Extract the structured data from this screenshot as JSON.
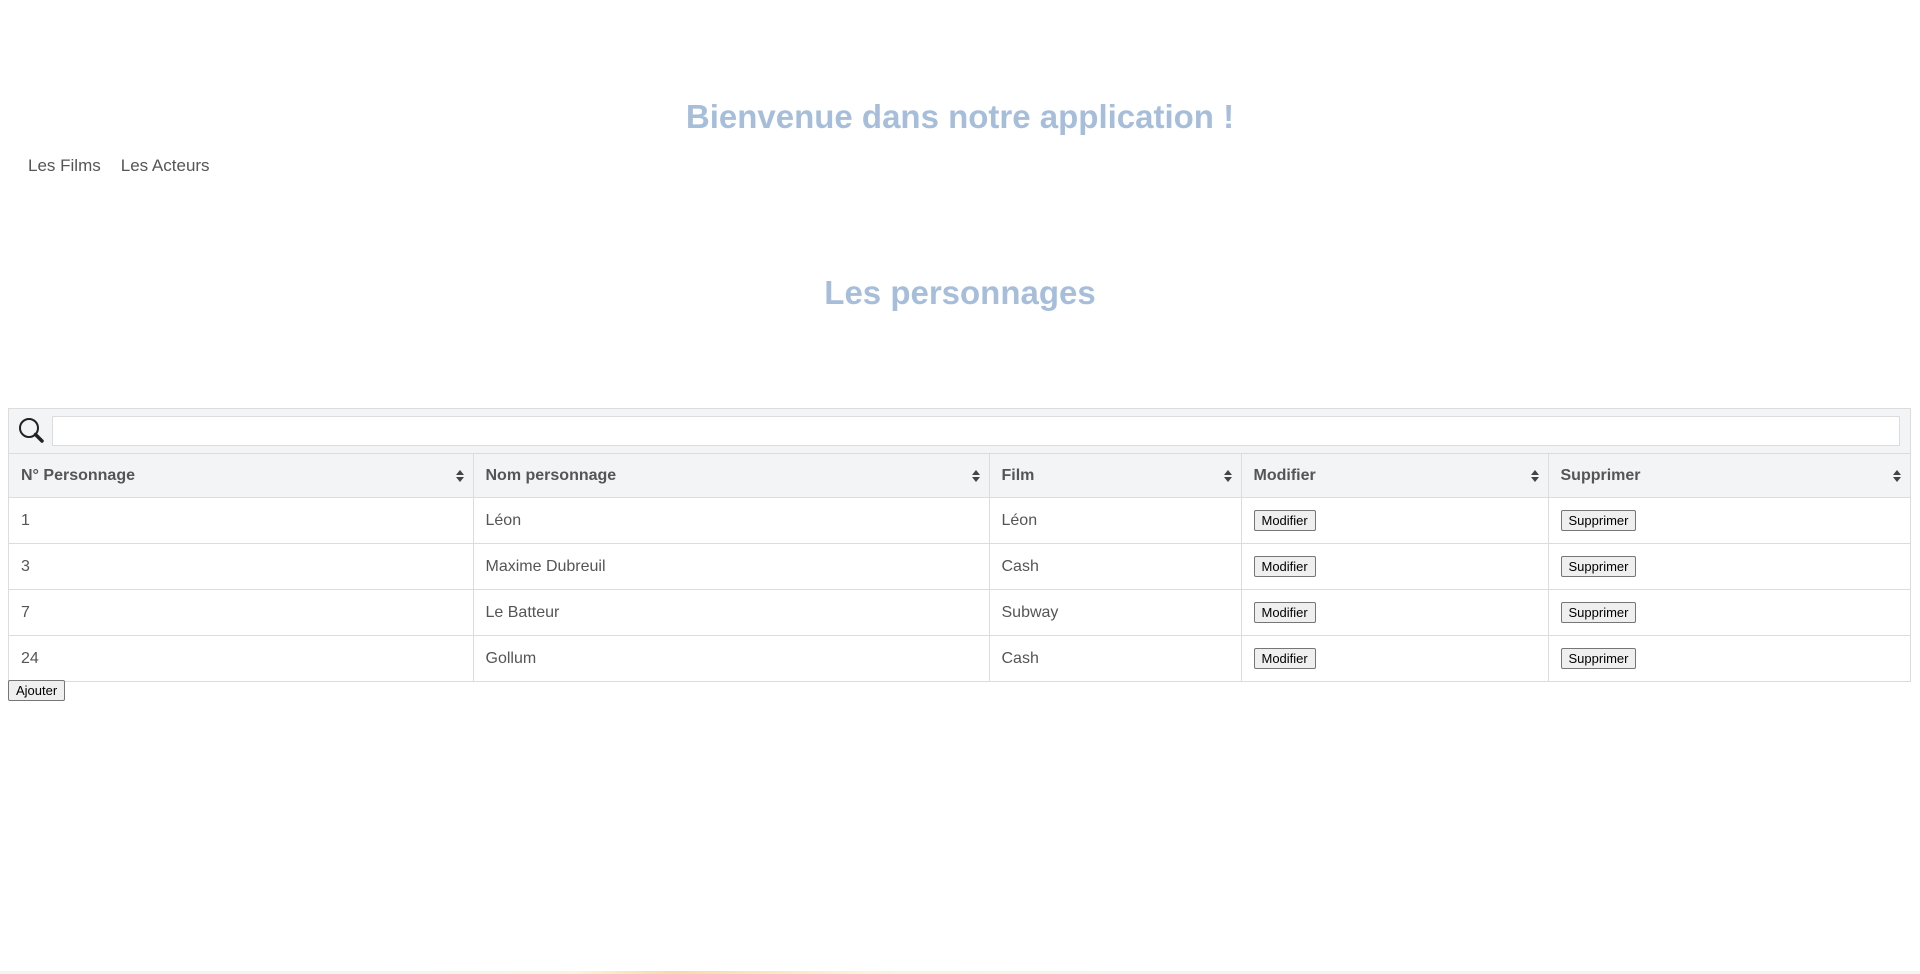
{
  "header": {
    "title": "Bienvenue dans notre application !"
  },
  "nav": {
    "items": [
      {
        "label": "Les Films"
      },
      {
        "label": "Les Acteurs"
      }
    ]
  },
  "page": {
    "title": "Les personnages"
  },
  "search": {
    "value": "",
    "placeholder": ""
  },
  "table": {
    "columns": [
      "N° Personnage",
      "Nom personnage",
      "Film",
      "Modifier",
      "Supprimer"
    ],
    "rows": [
      {
        "id": "1",
        "name": "Léon",
        "film": "Léon",
        "edit_label": "Modifier",
        "delete_label": "Supprimer"
      },
      {
        "id": "3",
        "name": "Maxime Dubreuil",
        "film": "Cash",
        "edit_label": "Modifier",
        "delete_label": "Supprimer"
      },
      {
        "id": "7",
        "name": "Le Batteur",
        "film": "Subway",
        "edit_label": "Modifier",
        "delete_label": "Supprimer"
      },
      {
        "id": "24",
        "name": "Gollum",
        "film": "Cash",
        "edit_label": "Modifier",
        "delete_label": "Supprimer"
      }
    ]
  },
  "actions": {
    "add_label": "Ajouter"
  },
  "colors": {
    "heading": "#a7bedb",
    "text": "#555555",
    "header_bg": "#f3f4f6",
    "border": "#dcdcdc"
  }
}
